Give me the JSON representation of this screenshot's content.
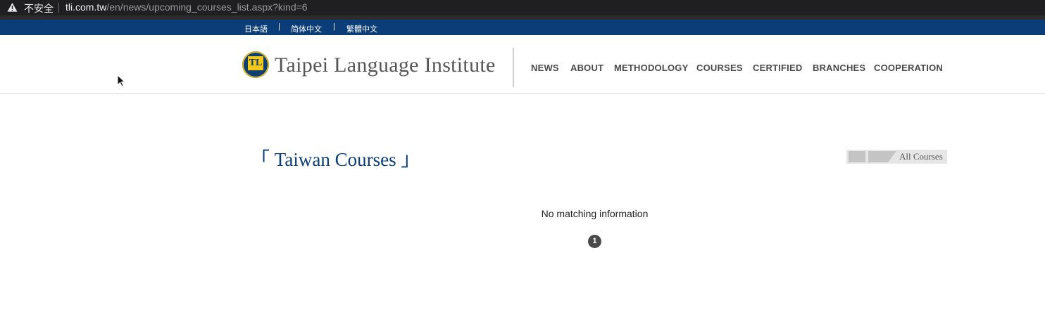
{
  "browser": {
    "security_label": "不安全",
    "url_host": "tli.com.tw",
    "url_path": "/en/news/upcoming_courses_list.aspx?kind=6"
  },
  "languages": [
    "日本語",
    "简体中文",
    "繁體中文"
  ],
  "language_separator": "|",
  "site": {
    "logo_mark": "TL",
    "name": "Taipei Language Institute"
  },
  "nav": [
    "NEWS",
    "ABOUT",
    "METHODOLOGY",
    "COURSES",
    "CERTIFIED",
    "BRANCHES",
    "COOPERATION"
  ],
  "page": {
    "title": "「 Taiwan Courses 」",
    "all_courses_label": "All Courses",
    "empty_message": "No matching information",
    "current_page": "1"
  },
  "colors": {
    "brand_blue": "#0b3e78",
    "logo_yellow": "#f3c816"
  },
  "icons": [
    "warning-icon",
    "cursor-pointer-icon"
  ]
}
